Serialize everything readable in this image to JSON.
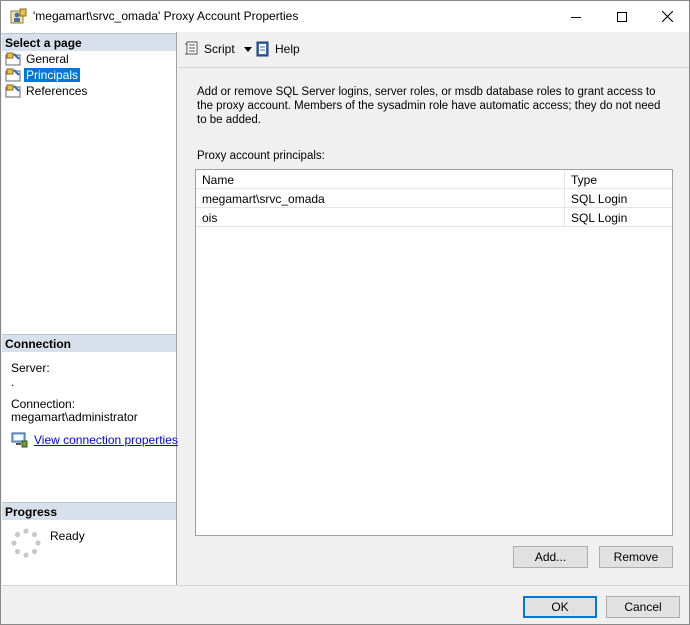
{
  "window": {
    "title": "'megamart\\srvc_omada' Proxy Account Properties",
    "controls": [
      "minimize-icon",
      "maximize-icon",
      "close-icon"
    ]
  },
  "left_panel": {
    "select_page_header": "Select a page",
    "pages": [
      {
        "label": "General",
        "icon": "page-icon",
        "selected": false
      },
      {
        "label": "Principals",
        "icon": "page-icon",
        "selected": true
      },
      {
        "label": "References",
        "icon": "page-icon",
        "selected": false
      }
    ],
    "connection_header": "Connection",
    "server_label": "Server:",
    "server_value": ".",
    "connection_label": "Connection:",
    "connection_value": "megamart\\administrator",
    "view_connection_link": "View connection properties",
    "progress_header": "Progress",
    "progress_status": "Ready"
  },
  "toolbar": {
    "script_label": "Script",
    "help_label": "Help"
  },
  "main": {
    "description": "Add or remove SQL Server logins, server roles, or msdb database roles to grant access to the proxy account. Members of the sysadmin role have automatic access; they do not need to be added.",
    "list_label": "Proxy account principals:",
    "columns": {
      "name": "Name",
      "type": "Type"
    },
    "rows": [
      {
        "name": "megamart\\srvc_omada",
        "type": "SQL Login"
      },
      {
        "name": "ois",
        "type": "SQL Login"
      }
    ],
    "add_label": "Add...",
    "remove_label": "Remove"
  },
  "footer": {
    "ok_label": "OK",
    "cancel_label": "Cancel"
  },
  "colors": {
    "selection": "#0078d7",
    "section_header": "#d8e0ec",
    "link": "#0000ee"
  }
}
